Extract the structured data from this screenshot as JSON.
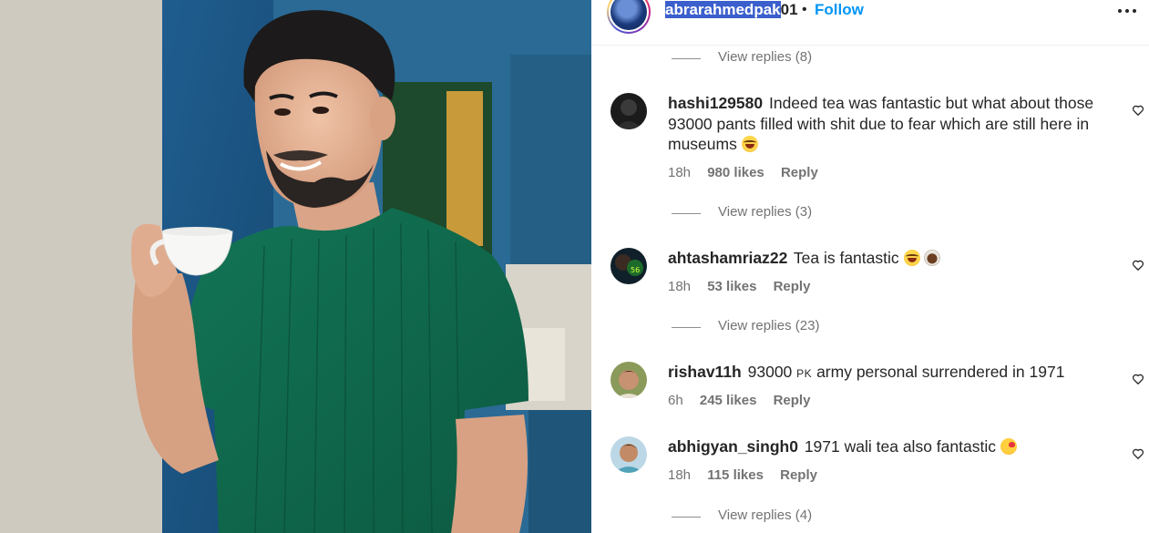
{
  "post": {
    "username_highlighted": "abrarahmedpak",
    "username_rest": "01",
    "separator": "•",
    "follow_label": "Follow",
    "more_icon": "more-horizontal-icon"
  },
  "thread": {
    "top_view_replies": "View replies (8)"
  },
  "comments": [
    {
      "username": "hashi129580",
      "text": "Indeed tea was fantastic but what about those 93000 pants filled with shit due to fear which are still here in museums",
      "emoji": "😂",
      "time": "18h",
      "likes": "980 likes",
      "reply": "Reply",
      "view_replies": "View replies (3)"
    },
    {
      "username": "ahtashamriaz22",
      "text": "Tea is fantastic",
      "emoji": "😂 ☕",
      "time": "18h",
      "likes": "53 likes",
      "reply": "Reply",
      "view_replies": "View replies (23)"
    },
    {
      "username": "rishav11h",
      "text_before": "93000",
      "text_small": "PK",
      "text_after": "army personal surrendered in 1971",
      "time": "6h",
      "likes": "245 likes",
      "reply": "Reply"
    },
    {
      "username": "abhigyan_singh0",
      "text": "1971 wali tea also fantastic",
      "emoji": "😘",
      "time": "18h",
      "likes": "115 likes",
      "reply": "Reply",
      "view_replies": "View replies (4)"
    }
  ],
  "colors": {
    "follow": "#0095f6",
    "username_highlight": "#3b5fcc",
    "meta_text": "#737373",
    "shirt": "#0f6b4f"
  }
}
